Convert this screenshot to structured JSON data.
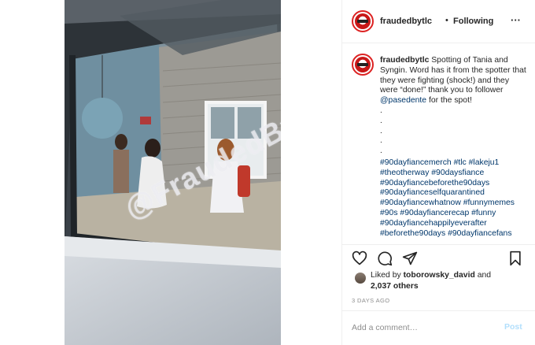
{
  "post": {
    "username": "fraudedbytlc",
    "separator": "•",
    "follow_status": "Following",
    "more_icon": "more-options-icon",
    "watermark_text": "@FraudedByTLC"
  },
  "caption": {
    "username": "fraudedbytlc",
    "text": " Spotting of Tania and Syngin. Word has it from the spotter that they were fighting (shock!) and they were “done!” thank you to follower ",
    "mention": "@pasedente",
    "text_after": " for the spot!",
    "dots": [
      ".",
      ".",
      ".",
      ".",
      "."
    ],
    "hashtags": [
      "#90dayfiancemerch #tlc #lakeju1",
      "#theotherway #90daysfiance",
      "#90dayfiancebeforethe90days",
      "#90dayfianceselfquarantined",
      "#90dayfiancewhatnow #funnymemes",
      "#90s #90dayfiancerecap #funny",
      "#90dayfiancehappilyeverafter",
      "#beforethe90days #90dayfiancefans"
    ]
  },
  "likes": {
    "prefix": "Liked by ",
    "user": "toborowsky_david",
    "and": " and",
    "count": "2,037 others"
  },
  "timestamp": "3 DAYS AGO",
  "comment": {
    "placeholder": "Add a comment…",
    "post_label": "Post"
  },
  "colors": {
    "link": "#00376b",
    "post_button_disabled": "#b2dffc",
    "muted": "#8e8e8e"
  }
}
